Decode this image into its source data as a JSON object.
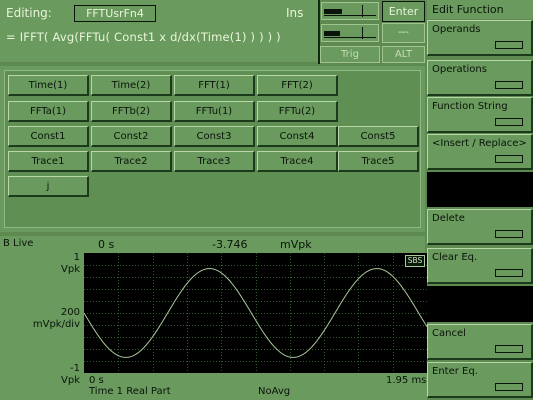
{
  "header": {
    "editing_label": "Editing:",
    "function_name": "FFTUsrFn4",
    "mode": "Ins",
    "formula": "= IFFT( Avg(FFTu( Const1 x d/dx(Time(1) ) ) ) )",
    "enter_label": "Enter",
    "dash_label": "---",
    "trig_label": "Trig",
    "alt_label": "ALT"
  },
  "operands": {
    "rows": [
      [
        "Time(1)",
        "Time(2)",
        "FFT(1)",
        "FFT(2)"
      ],
      [
        "FFTa(1)",
        "FFTb(2)",
        "FFTu(1)",
        "FFTu(2)"
      ],
      [
        "Const1",
        "Const2",
        "Const3",
        "Const4",
        "Const5"
      ],
      [
        "Trace1",
        "Trace2",
        "Trace3",
        "Trace4",
        "Trace5"
      ],
      [
        "j"
      ]
    ]
  },
  "sidebar": {
    "title": "Edit Function",
    "keys": [
      "Operands",
      "Operations",
      "Function String",
      "<Insert / Replace>",
      "Delete",
      "Clear Eq.",
      "Cancel",
      "Enter Eq."
    ]
  },
  "trace": {
    "title": "B Live",
    "marker_x": "0 s",
    "marker_y": "-3.746",
    "marker_unit": "mVpk",
    "y_top": "1",
    "y_top_unit": "Vpk",
    "y_scale": "200",
    "y_scale_unit": "mVpk/div",
    "y_bottom": "-1",
    "y_bottom_unit": "Vpk",
    "x_start": "0 s",
    "x_end": "1.95 ms",
    "trace_label": "Time 1 Real Part",
    "avg_label": "NoAvg",
    "badge": "SBS"
  },
  "colors": {
    "background": "#5e8a52",
    "panel": "#6a9a5e",
    "plot_bg": "#000000",
    "grid": "#2e5a2e",
    "trace": "#a9c99b"
  }
}
